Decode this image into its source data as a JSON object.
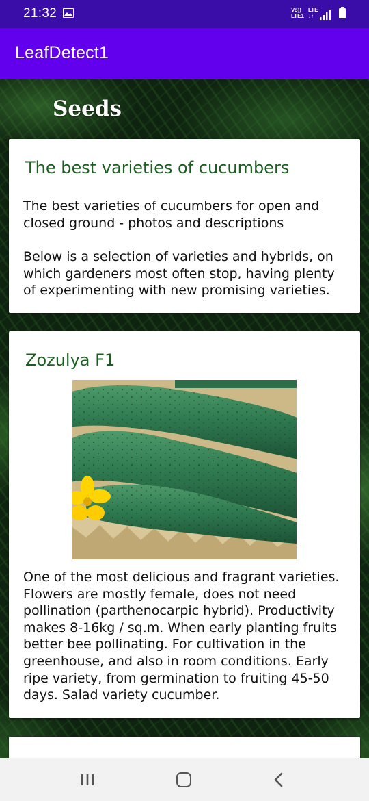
{
  "status_bar": {
    "time": "21:32",
    "gallery_icon": "image-icon",
    "network_top": "Vo))",
    "network_bottom": "LTE1",
    "lte_top": "LTE",
    "lte_bottom": "↓↑",
    "signal_icon": "signal-icon",
    "battery_icon": "battery-icon"
  },
  "app_bar": {
    "title": "LeafDetect1",
    "background_color": "#6200ee"
  },
  "section": {
    "title": "Seeds"
  },
  "cards": [
    {
      "heading": "The best varieties of cucumbers",
      "paragraphs": [
        "The best varieties of cucumbers for open and closed ground - photos and descriptions",
        "Below is a selection of varieties and hybrids, on which gardeners most often stop, having plenty of experimenting with new promising varieties."
      ]
    },
    {
      "heading": "Zozulya F1",
      "image": "cucumber-photo",
      "paragraphs": [
        "One of the most delicious and fragrant varieties. Flowers are mostly female, does not need pollination (parthenocarpic hybrid).  Productivity makes 8-16kg / sq.m. When early planting fruits better bee pollinating. For cultivation in the greenhouse, and also in room conditions.  Early ripe variety, from germination to fruiting 45-50 days.  Salad variety cucumber."
      ]
    },
    {
      "heading": "",
      "paragraphs": []
    }
  ],
  "nav_bar": {
    "recents_icon": "recents-icon",
    "home_icon": "home-icon",
    "back_icon": "back-icon"
  },
  "colors": {
    "heading_green": "#1b5e20",
    "status_bar": "#3a0ca8"
  }
}
